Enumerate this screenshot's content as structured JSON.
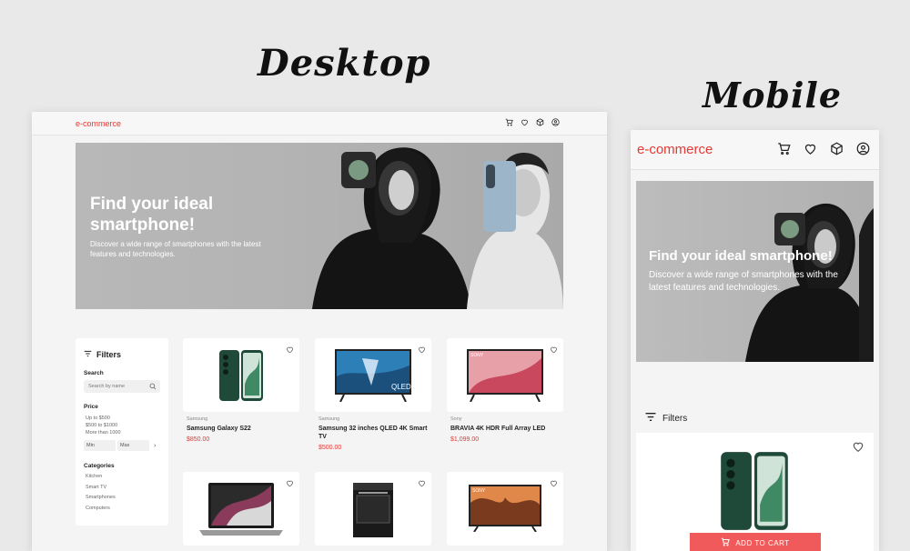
{
  "labels": {
    "desktop": "Desktop",
    "mobile": "Mobile"
  },
  "brand": "e-commerce",
  "colors": {
    "accent": "#e53935",
    "cart_button": "#f05a5a",
    "page_bg": "#e9e9e9"
  },
  "header_icons": [
    "cart-icon",
    "heart-icon",
    "box-icon",
    "user-icon"
  ],
  "hero": {
    "title_desktop": "Find your ideal smartphone!",
    "title_mobile": "Find your ideal smartphone!",
    "subtitle": "Discover a wide range of smartphones with the latest features and technologies."
  },
  "filters": {
    "title": "Filters",
    "search_label": "Search",
    "search_placeholder": "Search by name",
    "price_label": "Price",
    "price_options": [
      "Up to $500",
      "$500 to $1000",
      "More than 1000"
    ],
    "min": "Min",
    "max": "Max",
    "categories_label": "Categories",
    "categories": [
      "Kitchen",
      "Smart TV",
      "Smartphones",
      "Computers"
    ]
  },
  "products": [
    {
      "brand": "Samsung",
      "name": "Samsung Galaxy S22",
      "price": "$850.00",
      "kind": "phone"
    },
    {
      "brand": "Samsung",
      "name": "Samsung 32 inches QLED 4K Smart TV",
      "price": "$500.00",
      "kind": "tv-qled"
    },
    {
      "brand": "Sony",
      "name": "BRAVIA 4K HDR Full Array LED",
      "price": "$1,099.00",
      "kind": "tv-sony"
    },
    {
      "kind": "laptop"
    },
    {
      "kind": "stove"
    },
    {
      "kind": "tv-sony2"
    }
  ],
  "mobile": {
    "filters_label": "Filters",
    "add_to_cart": "ADD TO CART"
  }
}
